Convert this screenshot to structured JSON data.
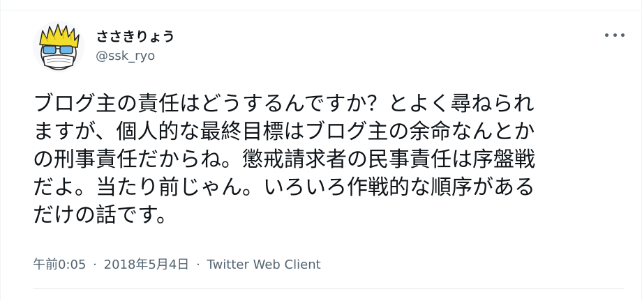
{
  "author": {
    "display_name": "ささきりょう",
    "handle": "@ssk_ryo",
    "avatar_icon": "cartoon-face-avatar"
  },
  "more_icon": "more-dots-icon",
  "tweet": {
    "lines": [
      "ブログ主の責任はどうするんですか？とよく尋ねられ",
      "ますが、個人的な最終目標はブログ主の余命なんとか",
      "の刑事責任だからね。懲戒請求者の民事責任は序盤戦",
      "だよ。当たり前じゃん。いろいろ作戦的な順序がある",
      "だけの話です。"
    ]
  },
  "meta": {
    "time": "午前0:05",
    "separator": "·",
    "date": "2018年5月4日",
    "client": "Twitter Web Client"
  },
  "colors": {
    "text_primary": "#0f1419",
    "text_secondary": "#536471",
    "divider": "#eff3f4"
  }
}
